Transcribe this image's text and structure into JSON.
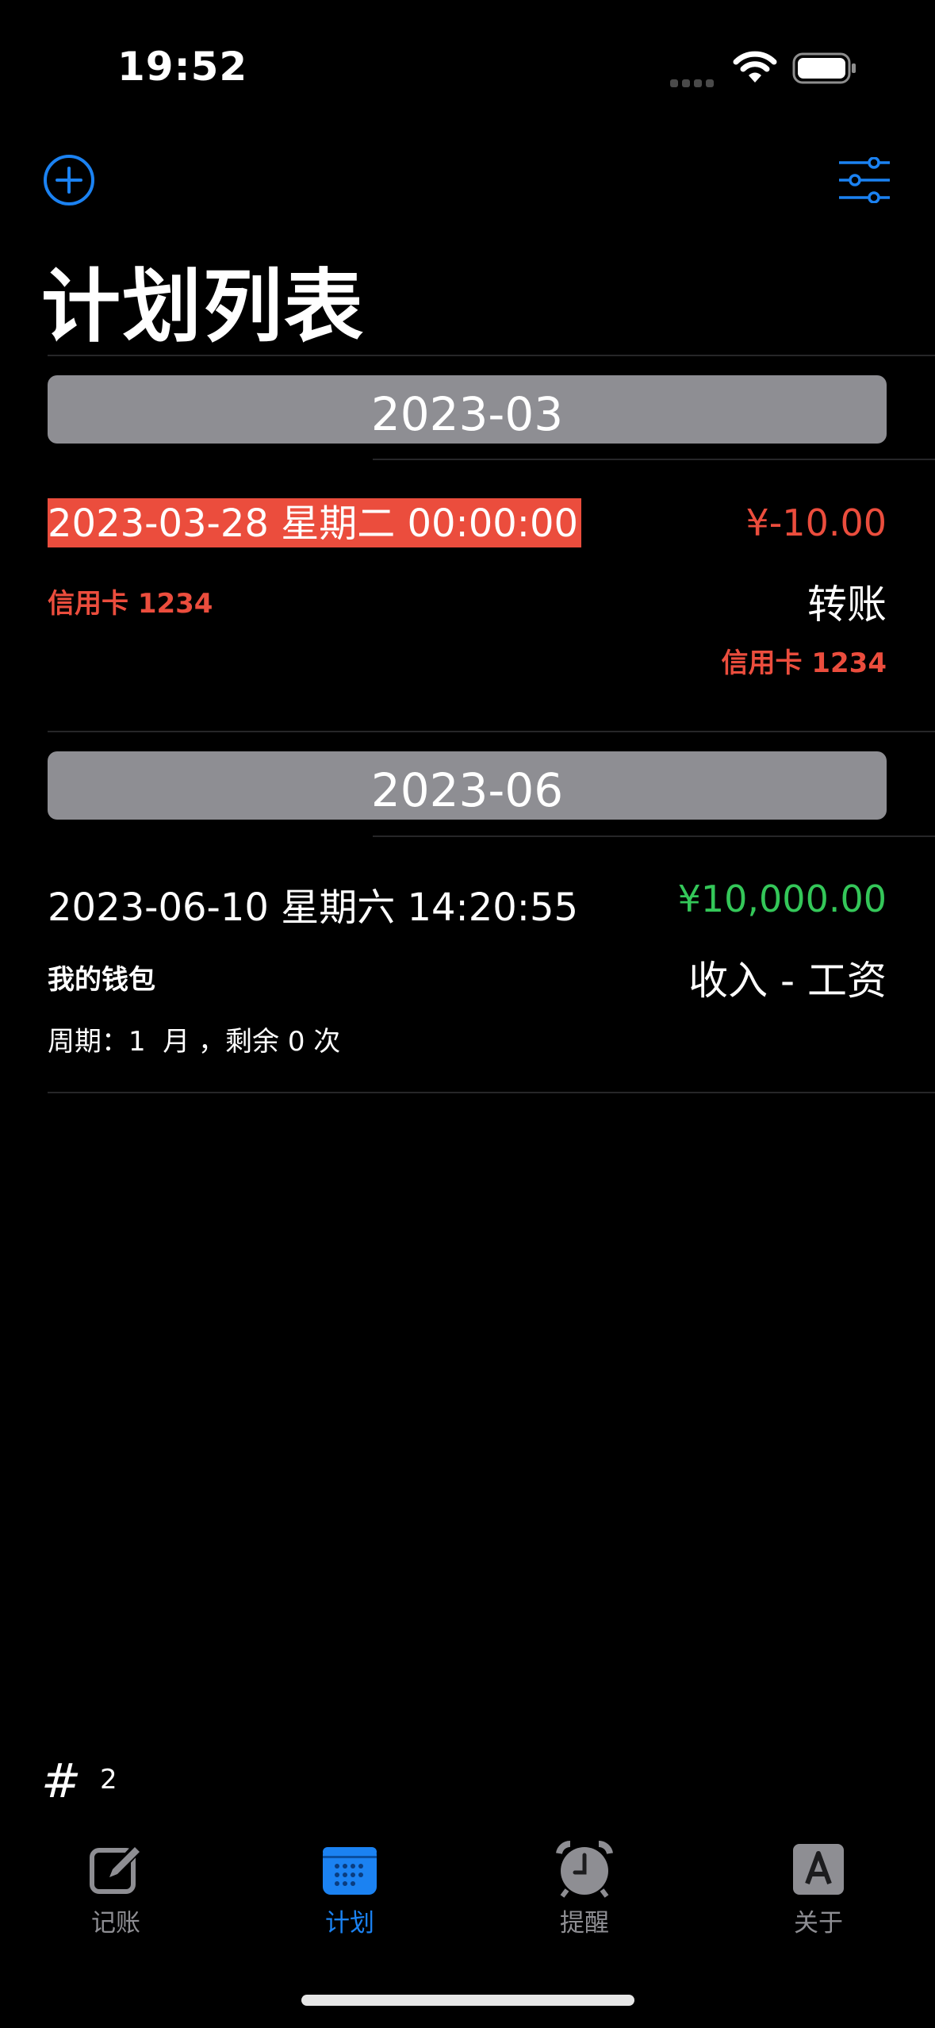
{
  "status_bar": {
    "time": "19:52"
  },
  "nav": {
    "title": "计划列表"
  },
  "colors": {
    "accent": "#1b82f2",
    "expense": "#eb4d3d",
    "income": "#34c759",
    "section": "#8e8e93"
  },
  "sections": [
    {
      "header": "2023-03",
      "entries": [
        {
          "date": "2023-03-28 星期二 00:00:00",
          "amount": "¥-10.00",
          "account": "信用卡 1234",
          "category": "转账",
          "target_account": "信用卡 1234"
        }
      ]
    },
    {
      "header": "2023-06",
      "entries": [
        {
          "date": "2023-06-10 星期六 14:20:55",
          "amount": "¥10,000.00",
          "account": "我的钱包",
          "category": "收入 - 工资",
          "cycle": "周期：1  月 ，剩余 0 次"
        }
      ]
    }
  ],
  "footer": {
    "count_symbol": "#",
    "count": "2"
  },
  "tabs": [
    {
      "label": "记账",
      "icon": "compose-icon"
    },
    {
      "label": "计划",
      "icon": "calendar-icon",
      "active": true
    },
    {
      "label": "提醒",
      "icon": "alarm-clock-icon"
    },
    {
      "label": "关于",
      "icon": "letter-a-icon"
    }
  ]
}
